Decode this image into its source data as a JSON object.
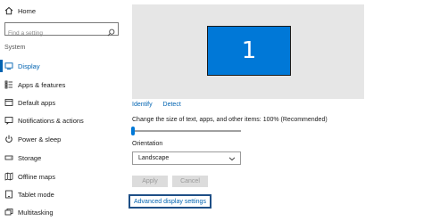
{
  "sidebar": {
    "home_label": "Home",
    "search_placeholder": "Find a setting",
    "section_label": "System",
    "items": [
      {
        "label": "Display",
        "icon": "monitor-icon",
        "active": true
      },
      {
        "label": "Apps & features",
        "icon": "apps-list-icon"
      },
      {
        "label": "Default apps",
        "icon": "default-apps-icon"
      },
      {
        "label": "Notifications & actions",
        "icon": "notifications-icon"
      },
      {
        "label": "Power & sleep",
        "icon": "power-icon"
      },
      {
        "label": "Storage",
        "icon": "storage-drive-icon"
      },
      {
        "label": "Offline maps",
        "icon": "map-icon"
      },
      {
        "label": "Tablet mode",
        "icon": "tablet-icon"
      },
      {
        "label": "Multitasking",
        "icon": "multitasking-icon"
      }
    ]
  },
  "main": {
    "monitor_number": "1",
    "identify_link": "Identify",
    "detect_link": "Detect",
    "scale_text": "Change the size of text, apps, and other items: 100% (Recommended)",
    "scale_value_fraction": 0,
    "orientation_label": "Orientation",
    "orientation_value": "Landscape",
    "apply_label": "Apply",
    "cancel_label": "Cancel",
    "advanced_link": "Advanced display settings"
  },
  "colors": {
    "accent": "#0078d7",
    "link": "#0063b1",
    "preview_bg": "#e6e6e6",
    "focus_border": "#1e4f86"
  }
}
